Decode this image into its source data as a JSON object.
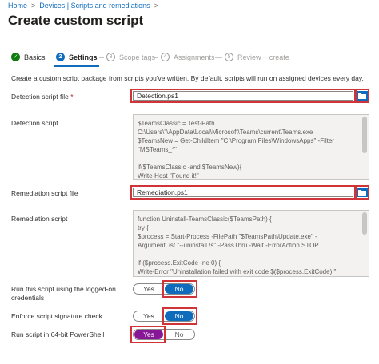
{
  "breadcrumb": {
    "items": [
      "Home",
      "Devices | Scripts and remediations"
    ]
  },
  "page": {
    "title": "Create custom script",
    "more": "..."
  },
  "steps": [
    {
      "num": "✓",
      "label": "Basics",
      "state": "done"
    },
    {
      "num": "2",
      "label": "Settings",
      "state": "active"
    },
    {
      "num": "3",
      "label": "Scope tags",
      "state": "todo"
    },
    {
      "num": "4",
      "label": "Assignments",
      "state": "todo"
    },
    {
      "num": "5",
      "label": "Review + create",
      "state": "todo"
    }
  ],
  "intro": "Create a custom script package from scripts you've written. By default, scripts will run on assigned devices every day.",
  "detection_file": {
    "label": "Detection script file",
    "required_mark": "*",
    "value": "Detection.ps1"
  },
  "detection_script": {
    "label": "Detection script",
    "lines": [
      "$TeamsClassic = Test-Path",
      "C:\\Users\\\"\\AppData\\Local\\Microsoft\\Teams\\current\\Teams.exe",
      "$TeamsNew = Get-ChildItem \"C:\\Program Files\\WindowsApps\" -Filter",
      "\"MSTeams_*\"",
      "",
      "if($TeamsClassic -and $TeamsNew){",
      "    Write-Host \"Found it!\""
    ]
  },
  "remediation_file": {
    "label": "Remediation script file",
    "value": "Remediation.ps1"
  },
  "remediation_script": {
    "label": "Remediation script",
    "lines": [
      "function Uninstall-TeamsClassic($TeamsPath) {",
      "    try {",
      "        $process = Start-Process -FilePath \"$TeamsPath\\Update.exe\" -",
      "ArgumentList \"--uninstall /s\" -PassThru -Wait -ErrorAction STOP",
      "",
      "        if ($process.ExitCode -ne 0) {",
      "            Write-Error \"Uninstallation failed with exit code $($process.ExitCode).\""
    ]
  },
  "toggles": {
    "logged_on": {
      "label_line1": "Run this script using the logged-on",
      "label_line2": "credentials",
      "yes": "Yes",
      "no": "No",
      "selected": "No"
    },
    "signature": {
      "label": "Enforce script signature check",
      "yes": "Yes",
      "no": "No",
      "selected": "No"
    },
    "powershell64": {
      "label": "Run script in 64-bit PowerShell",
      "yes": "Yes",
      "no": "No",
      "selected": "Yes"
    }
  },
  "colors": {
    "accent": "#0f6cbd",
    "highlight": "#d13438",
    "done": "#107c10",
    "purple": "#881798"
  }
}
